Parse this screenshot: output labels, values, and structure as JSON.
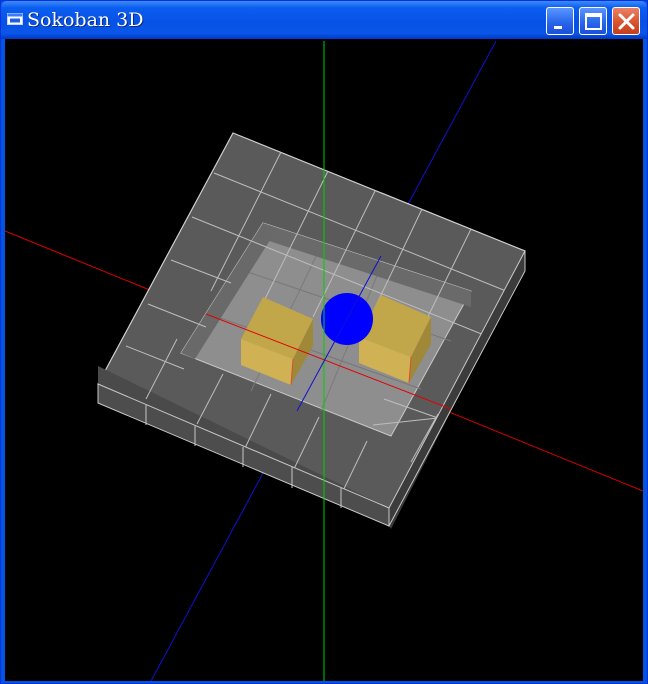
{
  "window": {
    "title": "Sokoban 3D",
    "icon": "app-window-icon",
    "buttons": {
      "minimize": "minimize-icon",
      "maximize": "maximize-icon",
      "close": "close-icon"
    }
  },
  "scene": {
    "background": "#000000",
    "axes": {
      "x": "#ff0000",
      "y": "#00ff00",
      "z": "#0000ff"
    },
    "wall_color": "#575757",
    "floor_color": "#8c8c8c",
    "box_color": "#c8a94a",
    "player_color": "#0000ff",
    "boxes": 2,
    "players": 1
  }
}
